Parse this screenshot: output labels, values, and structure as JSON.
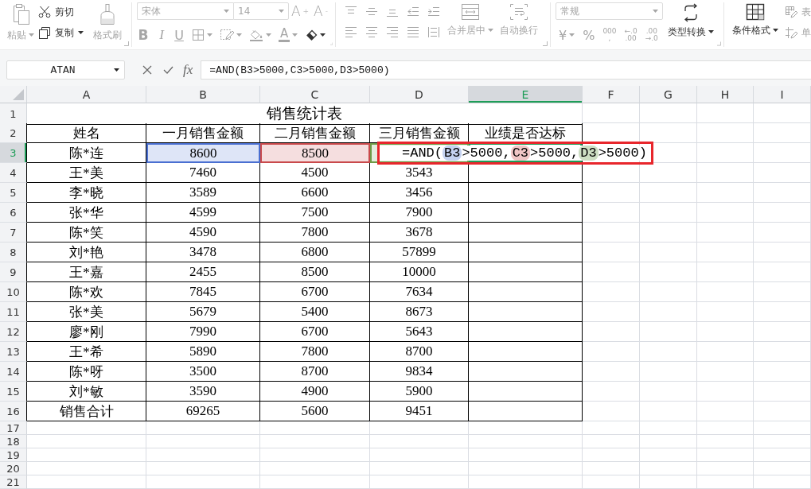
{
  "ribbon": {
    "clipboard": {
      "paste": {
        "label": "粘贴",
        "disabled": true,
        "dropdown": true
      },
      "cut": {
        "label": "剪切",
        "disabled": false
      },
      "copy": {
        "label": "复制",
        "disabled": false,
        "dropdown": true
      },
      "format_painter": {
        "label": "格式刷",
        "disabled": true
      }
    },
    "font": {
      "name": {
        "value": "宋体",
        "disabled": true
      },
      "size": {
        "value": "14",
        "disabled": true
      },
      "grow": {
        "text": "A$^{+}$",
        "disabled": true
      },
      "shrink": {
        "text": "A$^{-}$",
        "disabled": true
      },
      "bold": {
        "text": "B",
        "disabled": true
      },
      "italic": {
        "text": "I",
        "disabled": true
      },
      "underline": {
        "text": "U",
        "disabled": true
      },
      "borders": {
        "disabled": true,
        "dropdown": true
      },
      "pattern": {
        "disabled": true,
        "dropdown": true
      },
      "fill": {
        "disabled": true,
        "dropdown": true
      },
      "font_color": {
        "text": "A",
        "disabled": true,
        "dropdown": true
      },
      "clear": {
        "disabled": false,
        "dropdown": true
      }
    },
    "alignment": {
      "buttons": [
        {
          "disabled": true
        },
        {
          "disabled": true
        },
        {
          "disabled": true
        },
        {
          "disabled": true
        },
        {
          "disabled": true
        },
        {
          "disabled": true
        },
        {
          "disabled": true
        },
        {
          "disabled": true
        },
        {
          "disabled": true
        },
        {
          "disabled": true
        }
      ],
      "merge": {
        "label": "合并居中",
        "disabled": true,
        "dropdown": true
      },
      "wrap": {
        "label": "自动换行",
        "disabled": true
      }
    },
    "number": {
      "format": {
        "value": "常规",
        "disabled": true
      },
      "currency": {
        "text": "¥",
        "disabled": true,
        "dropdown": true
      },
      "percent": {
        "text": "%",
        "disabled": true
      },
      "thousands": {
        "lines": [
          "000",
          ","
        ],
        "disabled": true
      },
      "add_decimal": {
        "lines": [
          "←.0",
          ".00"
        ],
        "disabled": true
      },
      "remove_decimal": {
        "lines": [
          ".00",
          "→.0"
        ],
        "disabled": true
      },
      "convert": {
        "label": "类型转换",
        "disabled": false,
        "dropdown": true
      }
    },
    "styles": {
      "conditional": {
        "label": "条件格式",
        "disabled": false,
        "dropdown": true
      },
      "table_style": {
        "label": "表",
        "disabled": true
      },
      "cell_style": {
        "label": "单",
        "disabled": true
      }
    }
  },
  "formula_bar": {
    "name_box": "ATAN",
    "function_label": "fx",
    "formula": "=AND(B3>5000,C3>5000,D3>5000)"
  },
  "sheet": {
    "columns": [
      {
        "label": "A",
        "selected": false
      },
      {
        "label": "B",
        "selected": false
      },
      {
        "label": "C",
        "selected": false
      },
      {
        "label": "D",
        "selected": false
      },
      {
        "label": "E",
        "selected": true
      },
      {
        "label": "F",
        "selected": false
      },
      {
        "label": "G",
        "selected": false
      },
      {
        "label": "H",
        "selected": false
      },
      {
        "label": "I",
        "selected": false
      }
    ],
    "rows": [
      {
        "label": "1",
        "kind": "title",
        "selected": false,
        "title": "销售统计表"
      },
      {
        "label": "2",
        "kind": "header",
        "selected": false,
        "cells": [
          "姓名",
          "一月销售金额",
          "二月销售金额",
          "三月销售金额",
          "业绩是否达标"
        ]
      },
      {
        "label": "3",
        "kind": "editing",
        "selected": true,
        "cells": [
          {
            "text": "陈*连"
          },
          {
            "text": "8600",
            "color": "#4a6fd1"
          },
          {
            "text": "8500",
            "color": "#c9494b"
          },
          {
            "color": "#6e9b46"
          }
        ],
        "formula": [
          {
            "kind": "text",
            "text": "=AND("
          },
          {
            "kind": "ref",
            "text": "B3",
            "color": "#c4d2f0"
          },
          {
            "kind": "text",
            "text": ">5000,"
          },
          {
            "kind": "ref",
            "text": "C3",
            "color": "#f0c6c6"
          },
          {
            "kind": "text",
            "text": ">5000,"
          },
          {
            "kind": "ref",
            "text": "D3",
            "color": "#cddec3"
          },
          {
            "kind": "text",
            "text": ">5000)"
          }
        ],
        "annotation": {
          "kind": "rectangle"
        }
      },
      {
        "label": "4",
        "kind": "data",
        "selected": false,
        "cells": [
          "王*美",
          "7460",
          "4500",
          "3543"
        ]
      },
      {
        "label": "5",
        "kind": "data",
        "selected": false,
        "cells": [
          "李*晓",
          "3589",
          "6600",
          "3456"
        ]
      },
      {
        "label": "6",
        "kind": "data",
        "selected": false,
        "cells": [
          "张*华",
          "4599",
          "7500",
          "7900"
        ]
      },
      {
        "label": "7",
        "kind": "data",
        "selected": false,
        "cells": [
          "陈*笑",
          "4590",
          "7800",
          "3678"
        ]
      },
      {
        "label": "8",
        "kind": "data",
        "selected": false,
        "cells": [
          "刘*艳",
          "3478",
          "6800",
          "57899"
        ]
      },
      {
        "label": "9",
        "kind": "data",
        "selected": false,
        "cells": [
          "王*嘉",
          "2455",
          "8500",
          "10000"
        ]
      },
      {
        "label": "10",
        "kind": "data",
        "selected": false,
        "cells": [
          "陈*欢",
          "7845",
          "6700",
          "7634"
        ]
      },
      {
        "label": "11",
        "kind": "data",
        "selected": false,
        "cells": [
          "张*美",
          "5679",
          "5400",
          "8673"
        ]
      },
      {
        "label": "12",
        "kind": "data",
        "selected": false,
        "cells": [
          "廖*刚",
          "7990",
          "6700",
          "5643"
        ]
      },
      {
        "label": "13",
        "kind": "data",
        "selected": false,
        "cells": [
          "王*希",
          "5890",
          "7800",
          "8700"
        ]
      },
      {
        "label": "14",
        "kind": "data",
        "selected": false,
        "cells": [
          "陈*呀",
          "3500",
          "8700",
          "9834"
        ]
      },
      {
        "label": "15",
        "kind": "data",
        "selected": false,
        "cells": [
          "刘*敏",
          "3590",
          "4900",
          "5900"
        ]
      },
      {
        "label": "16",
        "kind": "data",
        "selected": false,
        "cells": [
          "销售合计",
          "69265",
          "5600",
          "9451"
        ]
      },
      {
        "label": "17",
        "kind": "empty",
        "selected": false
      },
      {
        "label": "18",
        "kind": "empty",
        "selected": false
      },
      {
        "label": "19",
        "kind": "empty",
        "selected": false
      },
      {
        "label": "20",
        "kind": "empty",
        "selected": false
      },
      {
        "label": "21",
        "kind": "empty",
        "selected": false
      }
    ]
  }
}
